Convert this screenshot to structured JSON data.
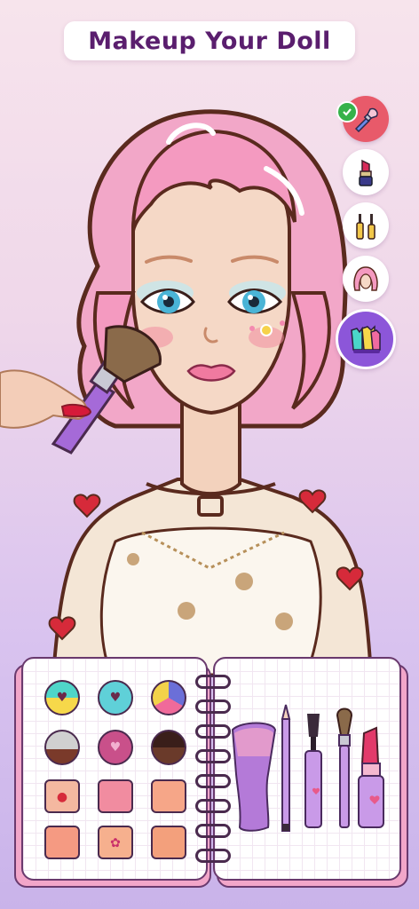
{
  "header": {
    "title": "Makeup Your Doll"
  },
  "tools": [
    {
      "name": "brush",
      "selected": true
    },
    {
      "name": "lipstick",
      "selected": false
    },
    {
      "name": "eye-makeup",
      "selected": false
    },
    {
      "name": "hair",
      "selected": false
    },
    {
      "name": "outfits",
      "selected": false
    }
  ],
  "palette": {
    "colors": {
      "accent": "#e85a6a",
      "outfit_button": "#8c56d9",
      "title_text": "#5a1e6e"
    },
    "swatches": [
      {
        "type": "eyeshadow",
        "colors": [
          "#4fd6c9",
          "#f6d84a"
        ],
        "icon": "heart-icon"
      },
      {
        "type": "eyeshadow",
        "colors": [
          "#5fd0d8"
        ],
        "icon": "heart-icon"
      },
      {
        "type": "eyeshadow",
        "colors": [
          "#6b6fd8",
          "#f06a9a",
          "#f2d24a"
        ],
        "icon": ""
      },
      {
        "type": "eyeshadow",
        "colors": [
          "#d0d0d0",
          "#7a3a2a"
        ],
        "icon": ""
      },
      {
        "type": "eyeshadow",
        "colors": [
          "#c9508a"
        ],
        "icon": "heart-icon"
      },
      {
        "type": "eyeshadow",
        "colors": [
          "#3a1e1a",
          "#6a3a2a"
        ],
        "icon": ""
      },
      {
        "type": "blush",
        "colors": [
          "#f4b8a0"
        ],
        "icon": "strawberry-icon"
      },
      {
        "type": "blush",
        "colors": [
          "#f18ca0"
        ],
        "icon": ""
      },
      {
        "type": "blush",
        "colors": [
          "#f6a688"
        ],
        "icon": ""
      },
      {
        "type": "blush",
        "colors": [
          "#f59a82"
        ],
        "icon": ""
      },
      {
        "type": "blush",
        "colors": [
          "#f6b08e"
        ],
        "icon": "butterfly-icon"
      },
      {
        "type": "blush",
        "colors": [
          "#f3a07c"
        ],
        "icon": ""
      }
    ],
    "tools": [
      "sponge-brush",
      "eyeliner-pencil",
      "mascara",
      "blush-brush",
      "lipstick"
    ]
  }
}
